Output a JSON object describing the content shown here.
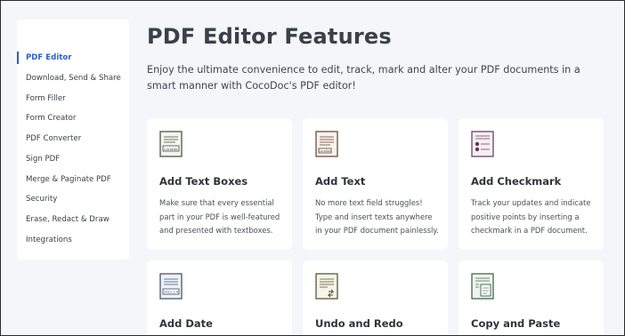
{
  "sidebar": {
    "items": [
      {
        "label": "PDF Editor",
        "active": true
      },
      {
        "label": "Download, Send & Share",
        "active": false
      },
      {
        "label": "Form Filler",
        "active": false
      },
      {
        "label": "Form Creator",
        "active": false
      },
      {
        "label": "PDF Converter",
        "active": false
      },
      {
        "label": "Sign PDF",
        "active": false
      },
      {
        "label": "Merge & Paginate PDF",
        "active": false
      },
      {
        "label": "Security",
        "active": false
      },
      {
        "label": "Erase, Redact & Draw",
        "active": false
      },
      {
        "label": "Integrations",
        "active": false
      }
    ]
  },
  "main": {
    "title": "PDF Editor Features",
    "description": "Enjoy the ultimate convenience to edit, track, mark and alter your PDF documents in a smart manner with CocoDoc's PDF editor!",
    "cards": [
      {
        "icon": "text-box-document-icon",
        "icon_text": "CocoDoc",
        "title": "Add Text Boxes",
        "description": "Make sure that every essential part in your PDF is well-featured and presented with textboxes."
      },
      {
        "icon": "text-document-icon",
        "icon_text": "CocoDoc",
        "title": "Add Text",
        "description": "No more text field struggles! Type and insert texts anywhere in your PDF document painlessly."
      },
      {
        "icon": "checkmark-document-icon",
        "title": "Add Checkmark",
        "description": "Track your updates and indicate positive points by inserting a checkmark in a PDF document."
      },
      {
        "icon": "date-document-icon",
        "icon_text": "2021.1.4",
        "title": "Add Date",
        "description": ""
      },
      {
        "icon": "undo-redo-document-icon",
        "title": "Undo and Redo",
        "description": ""
      },
      {
        "icon": "copy-paste-document-icon",
        "title": "Copy and Paste",
        "description": ""
      }
    ]
  },
  "colors": {
    "accent": "#2f5fc8",
    "background": "#f4f6f9",
    "card": "#ffffff"
  }
}
